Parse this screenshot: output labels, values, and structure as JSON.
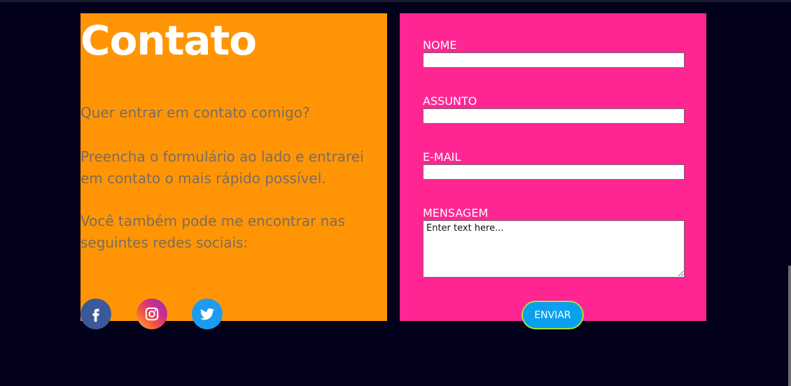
{
  "contact": {
    "title": "Contato",
    "paragraph_1": "Quer entrar em contato comigo?",
    "paragraph_2": "Preencha o formulário ao lado e entrarei em contato o mais rápido possível.",
    "paragraph_3": "Você também pode me encontrar nas seguintes redes sociais:",
    "socials": [
      {
        "name": "facebook",
        "icon": "facebook-icon",
        "color": "#3b5998"
      },
      {
        "name": "instagram",
        "icon": "instagram-icon",
        "color": "#e1306c"
      },
      {
        "name": "twitter",
        "icon": "twitter-icon",
        "color": "#1d9bf0"
      }
    ]
  },
  "form": {
    "name_label": "NOME",
    "subject_label": "ASSUNTO",
    "email_label": "E-MAIL",
    "message_label": "MENSAGEM",
    "message_placeholder": "Enter text here...",
    "name_value": "",
    "subject_value": "",
    "email_value": "",
    "send_label": "ENVIAR"
  },
  "colors": {
    "background": "#02001a",
    "left_panel": "#ff9505",
    "right_panel": "#ff2693",
    "button": "#0ba0ee",
    "button_border": "#a6e22e"
  }
}
